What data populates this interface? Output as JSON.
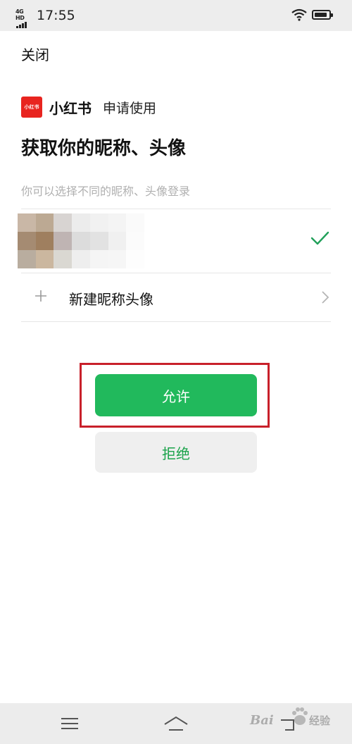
{
  "status_bar": {
    "network": "4G HD",
    "time": "17:55"
  },
  "header": {
    "close_label": "关闭"
  },
  "app": {
    "logo_text": "小红书",
    "name": "小红书",
    "request_text": "申请使用"
  },
  "permission": {
    "title": "获取你的昵称、头像",
    "subtitle": "你可以选择不同的昵称、头像登录"
  },
  "accounts": [
    {
      "selected": true
    }
  ],
  "new_profile": {
    "label": "新建昵称头像"
  },
  "actions": {
    "allow_label": "允许",
    "deny_label": "拒绝"
  },
  "colors": {
    "allow_button": "#21b95c",
    "deny_text": "#1aa34a",
    "check_mark": "#21a05a",
    "brand_red": "#e8241f",
    "highlight_box": "#c8202a"
  },
  "watermark": {
    "text_latin": "Bai",
    "text_cn": "经验"
  },
  "icons": [
    "signal-icon",
    "wifi-icon",
    "battery-icon",
    "check-icon",
    "plus-icon",
    "chevron-right-icon",
    "menu-icon",
    "home-icon",
    "back-icon"
  ]
}
